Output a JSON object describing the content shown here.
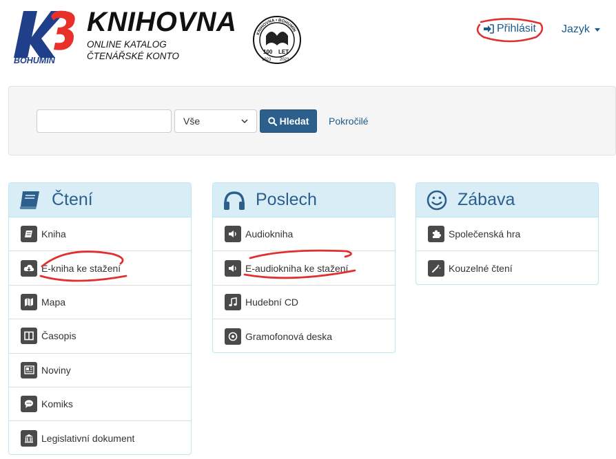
{
  "header": {
    "logo_k3": "K3",
    "logo_city": "BOHUMÍN",
    "brand_title": "KNIHOVNA",
    "brand_line1": "ONLINE KATALOG",
    "brand_line2": "ČTENÁŘSKÉ KONTO",
    "seal_top": "KNIHOVNA • BOHUMÍN",
    "seal_year_left": "1923",
    "seal_year_right": "2023",
    "seal_letters_left": "100",
    "seal_letters_right": "LET",
    "login_label": "Přihlásit",
    "language_label": "Jazyk"
  },
  "search": {
    "input_value": "",
    "input_placeholder": "",
    "scope_selected": "Vše",
    "button_label": "Hledat",
    "advanced_label": "Pokročilé"
  },
  "panels": [
    {
      "title": "Čtení",
      "icon": "book-icon",
      "items": [
        {
          "label": "Kniha",
          "icon": "book-small-icon"
        },
        {
          "label": "E-kniha ke stažení",
          "icon": "cloud-download-icon"
        },
        {
          "label": "Mapa",
          "icon": "map-icon"
        },
        {
          "label": "Časopis",
          "icon": "columns-icon"
        },
        {
          "label": "Noviny",
          "icon": "newspaper-icon"
        },
        {
          "label": "Komiks",
          "icon": "speech-bubble-icon"
        },
        {
          "label": "Legislativní dokument",
          "icon": "institution-icon"
        }
      ]
    },
    {
      "title": "Poslech",
      "icon": "headphones-icon",
      "items": [
        {
          "label": "Audiokniha",
          "icon": "speaker-icon"
        },
        {
          "label": "E-audiokniha ke stažení",
          "icon": "speaker-icon"
        },
        {
          "label": "Hudební CD",
          "icon": "music-note-icon"
        },
        {
          "label": "Gramofonová deska",
          "icon": "record-icon"
        }
      ]
    },
    {
      "title": "Zábava",
      "icon": "smiley-icon",
      "items": [
        {
          "label": "Společenská hra",
          "icon": "puzzle-icon"
        },
        {
          "label": "Kouzelné čtení",
          "icon": "magic-wand-icon"
        }
      ]
    }
  ],
  "colors": {
    "link": "#1b5a8a",
    "panel_header_bg": "#d9edf7",
    "panel_border": "#bce8f1",
    "button_bg": "#2c5f8c",
    "logo_blue": "#1f3f8a",
    "annotation_red": "#e03030"
  }
}
